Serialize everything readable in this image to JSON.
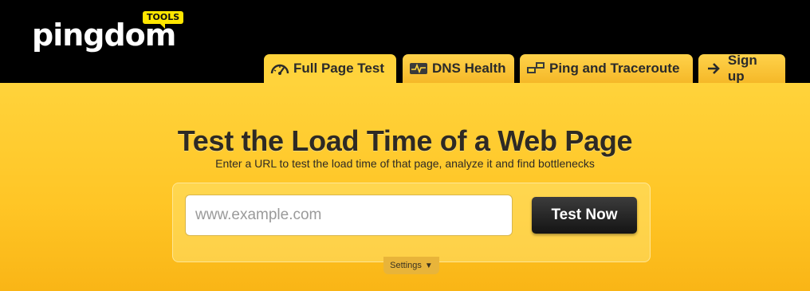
{
  "brand": {
    "logo_text": "pingdom",
    "badge_text": "TOOLS"
  },
  "tabs": [
    {
      "label": "Full Page Test",
      "icon": "speedometer-icon",
      "active": true
    },
    {
      "label": "DNS Health",
      "icon": "heartbeat-monitor-icon",
      "active": false
    },
    {
      "label": "Ping and Traceroute",
      "icon": "network-computers-icon",
      "active": false
    },
    {
      "label": "Sign up",
      "icon": "arrow-right-icon",
      "active": false
    }
  ],
  "main": {
    "title": "Test the Load Time of a Web Page",
    "subtitle": "Enter a URL to test the load time of that page, analyze it and find bottlenecks",
    "url_input": {
      "value": "",
      "placeholder": "www.example.com"
    },
    "test_button_label": "Test Now",
    "settings_label": "Settings",
    "settings_arrow": "▼"
  },
  "colors": {
    "header_bg": "#000000",
    "tab_bg": "#ffd33b",
    "main_bg_top": "#ffd33b",
    "main_bg_bottom": "#f9b516",
    "button_bg": "#1e1e1e"
  }
}
